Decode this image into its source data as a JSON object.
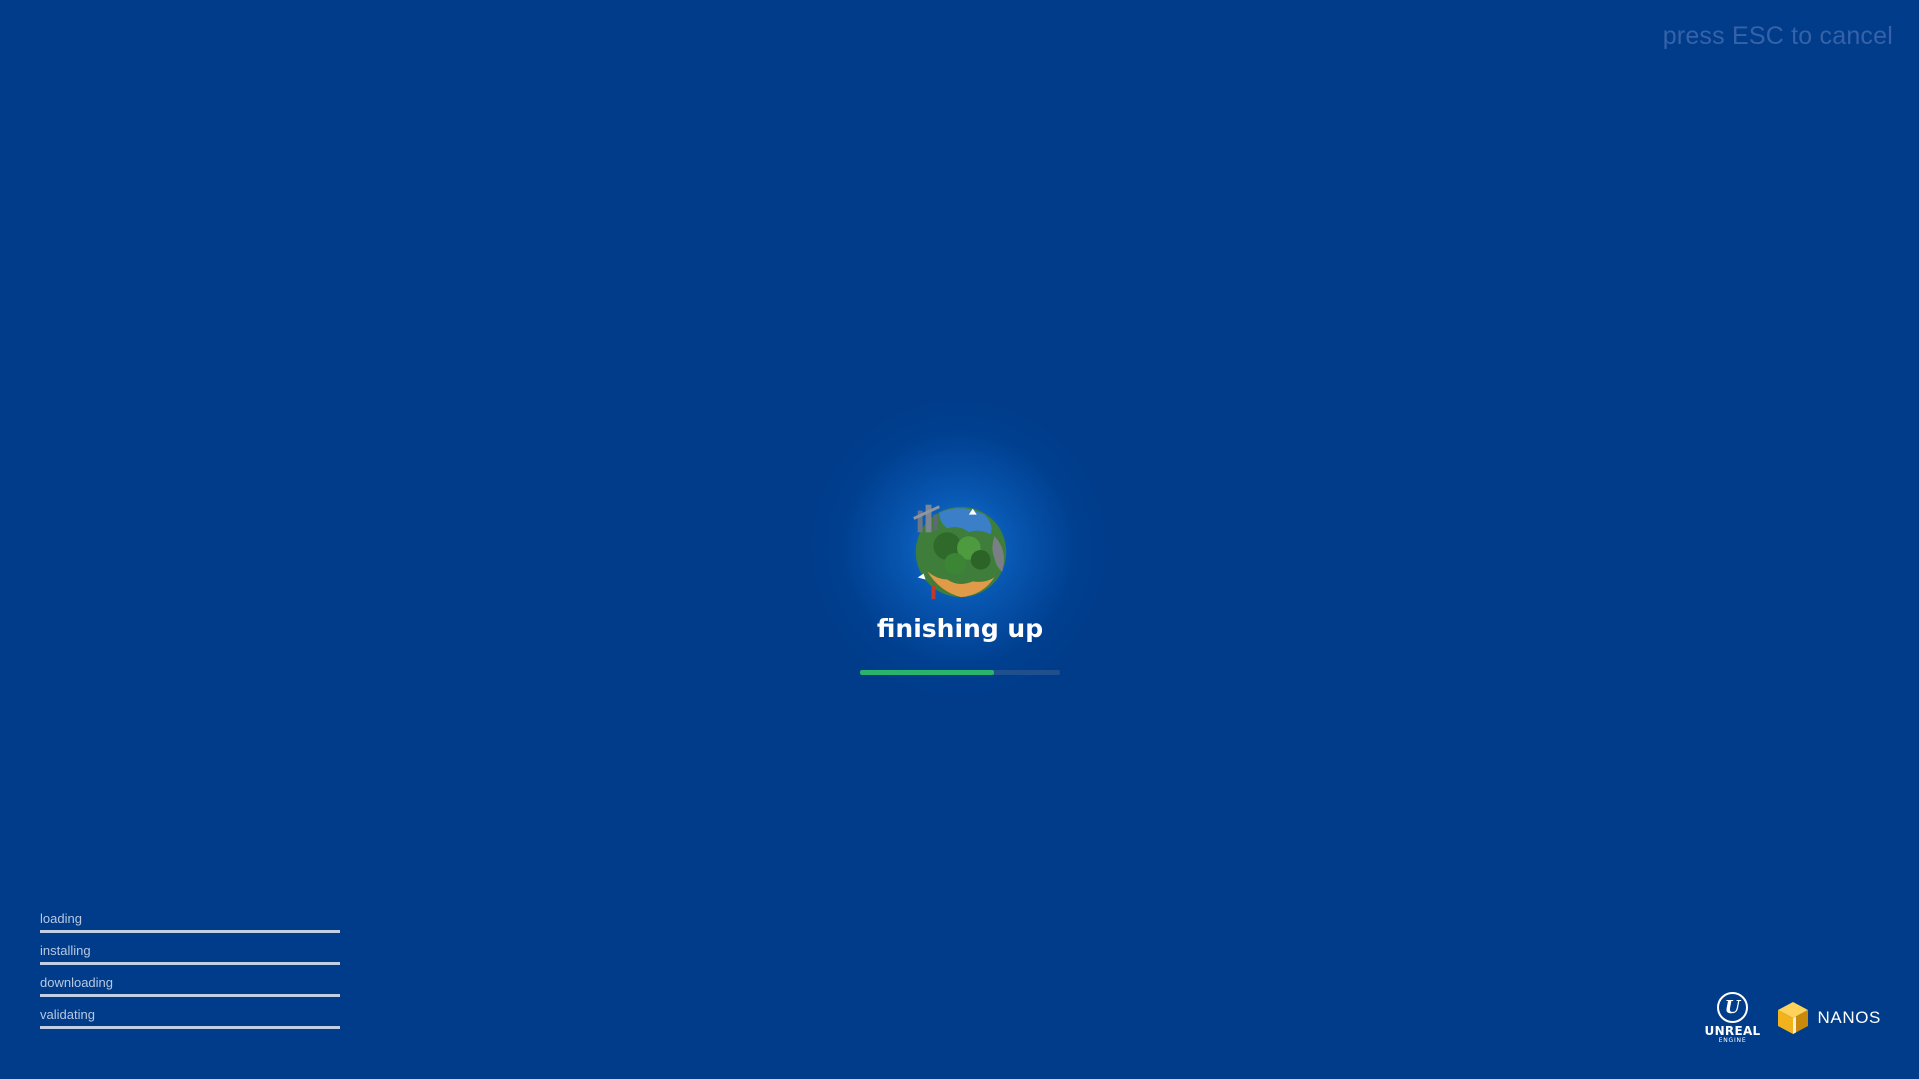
{
  "cancel_hint": "press ESC to cancel",
  "status": {
    "title": "finishing up",
    "progress": 0.67
  },
  "tasks": [
    {
      "label": "loading",
      "progress": 1.0
    },
    {
      "label": "installing",
      "progress": 1.0
    },
    {
      "label": "downloading",
      "progress": 1.0
    },
    {
      "label": "validating",
      "progress": 1.0
    }
  ],
  "logos": {
    "unreal_word": "UNREAL",
    "unreal_sub": "ENGINE",
    "unreal_mark": "U",
    "nanos_word": "NANOS"
  },
  "icons": {
    "planet": "planet-globe-icon",
    "unreal": "unreal-engine-logo-icon",
    "nanos": "nanos-cube-icon"
  },
  "colors": {
    "background": "#003c8a",
    "progress_fill": "#29b36c",
    "progress_track": "#204f8e",
    "task_bar": "#c4cfe3",
    "hint_text": "#3562a8",
    "nanos_cube": "#f2b21b"
  }
}
